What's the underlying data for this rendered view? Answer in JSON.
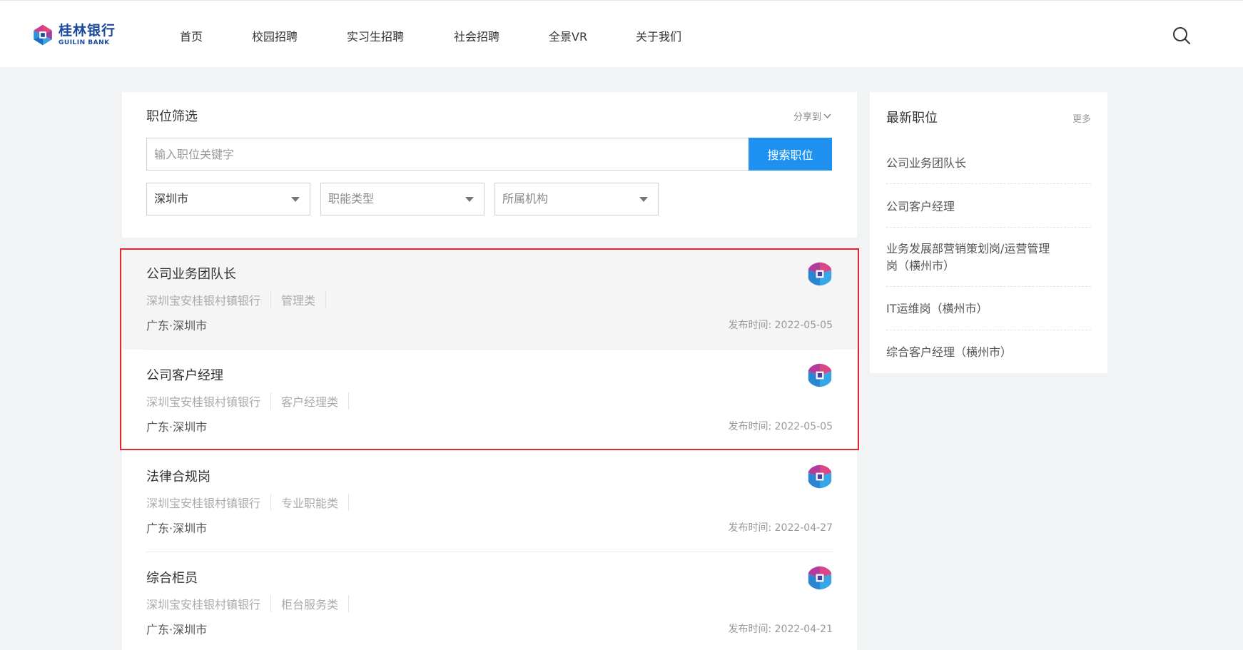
{
  "brand": {
    "name_cn": "桂林银行",
    "name_en": "GUILIN BANK"
  },
  "nav": {
    "items": [
      "首页",
      "校园招聘",
      "实习生招聘",
      "社会招聘",
      "全景VR",
      "关于我们"
    ]
  },
  "filter": {
    "title": "职位筛选",
    "share_label": "分享到",
    "search_placeholder": "输入职位关键字",
    "search_button": "搜索职位",
    "city_value": "深圳市",
    "function_placeholder": "职能类型",
    "org_placeholder": "所属机构"
  },
  "jobs": [
    {
      "title": "公司业务团队长",
      "org": "深圳宝安桂银村镇银行",
      "category": "管理类",
      "location": "广东·深圳市",
      "date_label": "发布时间:",
      "date": "2022-05-05"
    },
    {
      "title": "公司客户经理",
      "org": "深圳宝安桂银村镇银行",
      "category": "客户经理类",
      "location": "广东·深圳市",
      "date_label": "发布时间:",
      "date": "2022-05-05"
    },
    {
      "title": "法律合规岗",
      "org": "深圳宝安桂银村镇银行",
      "category": "专业职能类",
      "location": "广东·深圳市",
      "date_label": "发布时间:",
      "date": "2022-04-27"
    },
    {
      "title": "综合柜员",
      "org": "深圳宝安桂银村镇银行",
      "category": "柜台服务类",
      "location": "广东·深圳市",
      "date_label": "发布时间:",
      "date": "2022-04-21"
    }
  ],
  "latest": {
    "title": "最新职位",
    "more": "更多",
    "items": [
      "公司业务团队长",
      "公司客户经理",
      "业务发展部营销策划岗/运营管理岗（横州市）",
      "IT运维岗（横州市）",
      "综合客户经理（横州市）"
    ]
  },
  "colors": {
    "accent": "#1e90f0",
    "brand_blue": "#1a4a9e",
    "highlight_frame": "#e0282e"
  }
}
